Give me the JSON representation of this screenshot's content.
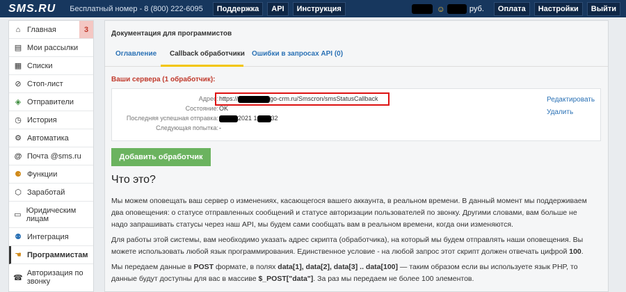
{
  "header": {
    "logo": "SMS.RU",
    "free_number_label": "Бесплатный номер - 8 (800) 222-6095",
    "nav": [
      "Поддержка",
      "API",
      "Инструкция"
    ],
    "balance_suffix": "руб.",
    "right_buttons": [
      "Оплата",
      "Настройки",
      "Выйти"
    ]
  },
  "sidebar": {
    "items": [
      {
        "label": "Главная",
        "icon": "home-icon",
        "glyph": "⌂",
        "badge": "3"
      },
      {
        "label": "Мои рассылки",
        "icon": "page-icon",
        "glyph": "▤"
      },
      {
        "label": "Списки",
        "icon": "list-icon",
        "glyph": "▦"
      },
      {
        "label": "Стоп-лист",
        "icon": "stop-list-icon",
        "glyph": "⊘"
      },
      {
        "label": "Отправители",
        "icon": "tag-icon",
        "glyph": "◈"
      },
      {
        "label": "История",
        "icon": "clock-icon",
        "glyph": "◷"
      },
      {
        "label": "Автоматика",
        "icon": "gear-icon",
        "glyph": "⚙"
      },
      {
        "label": "Почта @sms.ru",
        "icon": "at-icon",
        "glyph": "@"
      },
      {
        "label": "Функции",
        "icon": "functions-icon",
        "glyph": "⚈"
      },
      {
        "label": "Заработай",
        "icon": "money-icon",
        "glyph": "⬡"
      },
      {
        "label": "Юридическим лицам",
        "icon": "document-icon",
        "glyph": "▭"
      },
      {
        "label": "Интеграция",
        "icon": "integration-icon",
        "glyph": "⚉"
      },
      {
        "label": "Программистам",
        "icon": "hand-icon",
        "glyph": "☚",
        "active": true
      },
      {
        "label": "Авторизация по звонку",
        "icon": "phone-icon",
        "glyph": "☎"
      }
    ]
  },
  "main": {
    "title": "Документация для программистов",
    "tabs": [
      "Оглавление",
      "Callback обработчики",
      "Ошибки в запросах API (0)"
    ],
    "servers_title": "Ваши сервера (1 обработчик):",
    "handler": {
      "labels": [
        "Адрес:",
        "Состояние:",
        "Последняя успешная отправка:",
        "Следующая попытка:"
      ],
      "address_prefix": "https://",
      "address_suffix": "go-crm.ru/Smscron/smsStatusCallback",
      "status": "OK",
      "last_sent_mid": "2021 1",
      "last_sent_end": "32",
      "next_attempt": "-",
      "edit_link": "Редактировать",
      "delete_link": "Удалить"
    },
    "add_button": "Добавить обработчик",
    "heading": "Что это?",
    "para1": "Мы можем оповещать ваш сервер о изменениях, касающегося вашего аккаунта, в реальном времени. В данный момент мы поддерживаем два оповещения: о статусе отправленных сообщений и статусе авторизации пользователей по звонку. Другими словами, вам больше не надо запрашивать статусы через наш API, мы будем сами сообщать вам в реальном времени, когда они изменяются.",
    "para2_text": "Для работы этой системы, вам необходимо указать адрес скрипта (обработчика), на который мы будем отправлять наши оповещения. Вы можете использовать любой язык программирования. Единственное условие - на любой запрос этот скрипт должен отвечать цифрой ",
    "para2_bold": "100",
    "para2_end": ".",
    "para3_1": "Мы передаем данные в ",
    "para3_post": "POST",
    "para3_2": " формате, в полях ",
    "para3_fields": "data[1], data[2], data[3] .. data[100]",
    "para3_3": " — таким образом если вы используете язык PHP, то данные будут доступны для вас в массиве ",
    "para3_arr": "$_POST[\"data\"]",
    "para3_4": ". За раз мы передаем не более 100 элементов."
  },
  "colors": {
    "topbar": "#17375e",
    "accent_yellow": "#f2c500",
    "link": "#2a71b5",
    "alert_red": "#c0392b",
    "button_green": "#6bb35f"
  }
}
